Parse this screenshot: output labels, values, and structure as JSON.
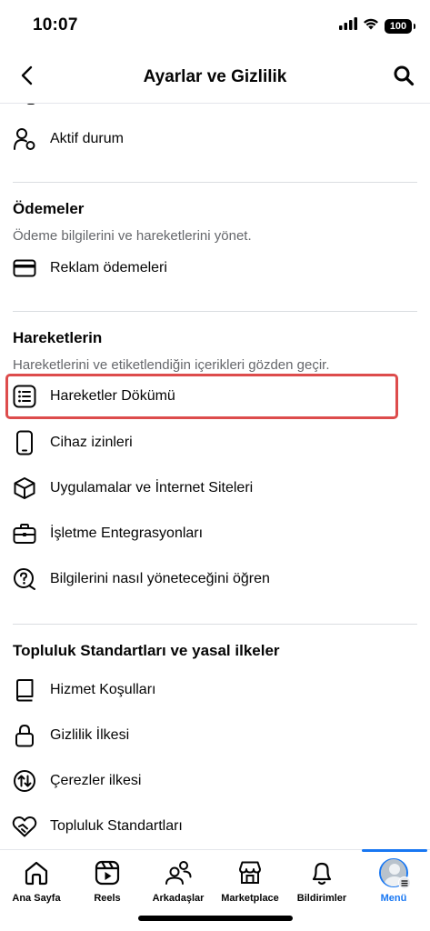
{
  "status_bar": {
    "time": "10:07",
    "battery": "100"
  },
  "header": {
    "title": "Ayarlar ve Gizlilik"
  },
  "items": {
    "active_status": "Aktif durum",
    "ad_payments": "Reklam ödemeleri",
    "activity_log": "Hareketler Dökümü",
    "device_permissions": "Cihaz izinleri",
    "apps_websites": "Uygulamalar ve İnternet Siteleri",
    "business_integrations": "İşletme Entegrasyonları",
    "manage_info": "Bilgilerini nasıl yöneteceğini öğren",
    "terms": "Hizmet Koşulları",
    "privacy_policy": "Gizlilik İlkesi",
    "cookies_policy": "Çerezler ilkesi",
    "community_standards": "Topluluk Standartları"
  },
  "sections": {
    "payments": {
      "title": "Ödemeler",
      "subtitle": "Ödeme bilgilerini ve hareketlerini yönet."
    },
    "activity": {
      "title": "Hareketlerin",
      "subtitle": "Hareketlerini ve etiketlendiğin içerikleri gözden geçir."
    },
    "standards": {
      "title": "Topluluk Standartları ve yasal ilkeler"
    }
  },
  "bottom_nav": {
    "home": "Ana Sayfa",
    "reels": "Reels",
    "friends": "Arkadaşlar",
    "marketplace": "Marketplace",
    "notifications": "Bildirimler",
    "menu": "Menü"
  },
  "colors": {
    "accent": "#1877f2",
    "highlight": "#dd4c4c",
    "secondary_text": "#65676b"
  }
}
